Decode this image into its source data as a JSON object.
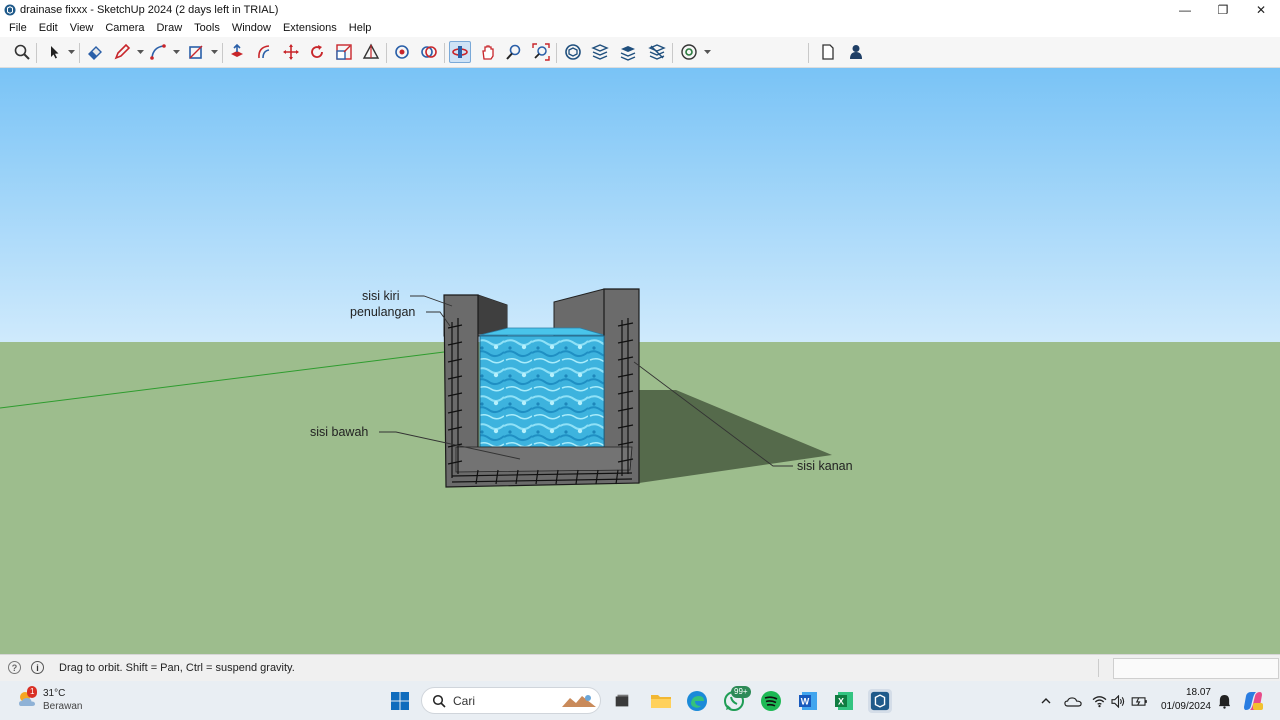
{
  "window": {
    "title": "drainase fixxx - SketchUp 2024 (2 days left in TRIAL)",
    "minimize_glyph": "—",
    "maximize_glyph": "❐",
    "close_glyph": "✕"
  },
  "menu": {
    "items": [
      "File",
      "Edit",
      "View",
      "Camera",
      "Draw",
      "Tools",
      "Window",
      "Extensions",
      "Help"
    ]
  },
  "toolbar": {
    "tools": [
      "search-icon",
      "select-icon",
      "eraser-icon",
      "line-pencil-icon",
      "arc-icon",
      "rectangle-icon",
      "push-pull-icon",
      "offset-icon",
      "move-icon",
      "rotate-icon",
      "scale-icon",
      "tape-measure-icon",
      "paint-bucket-icon",
      "orbit-icon",
      "pan-icon",
      "zoom-icon",
      "zoom-extents-icon",
      "3d-warehouse-icon",
      "extension-warehouse-icon",
      "layout-icon",
      "extension-manager-icon",
      "styles-icon",
      "new-file-icon",
      "account-icon"
    ],
    "active_tool": "orbit-icon"
  },
  "viewport": {
    "sky_color": "#86cbf7",
    "ground_color": "#9dbd8d",
    "labels": {
      "left_side": "sisi kiri",
      "rebar": "penulangan",
      "bottom": "sisi bawah",
      "right_side": "sisi kanan"
    }
  },
  "statusbar": {
    "help_icon": "question-icon",
    "info_icon": "info-icon",
    "text": "Drag to orbit. Shift = Pan, Ctrl = suspend gravity.",
    "measurements_value": ""
  },
  "taskbar": {
    "weather": {
      "temp": "31°C",
      "desc": "Berawan",
      "alert_count": "1"
    },
    "search_placeholder": "Cari",
    "whatsapp_badge": "99+",
    "clock": {
      "time": "18.07",
      "date": "01/09/2024"
    }
  }
}
